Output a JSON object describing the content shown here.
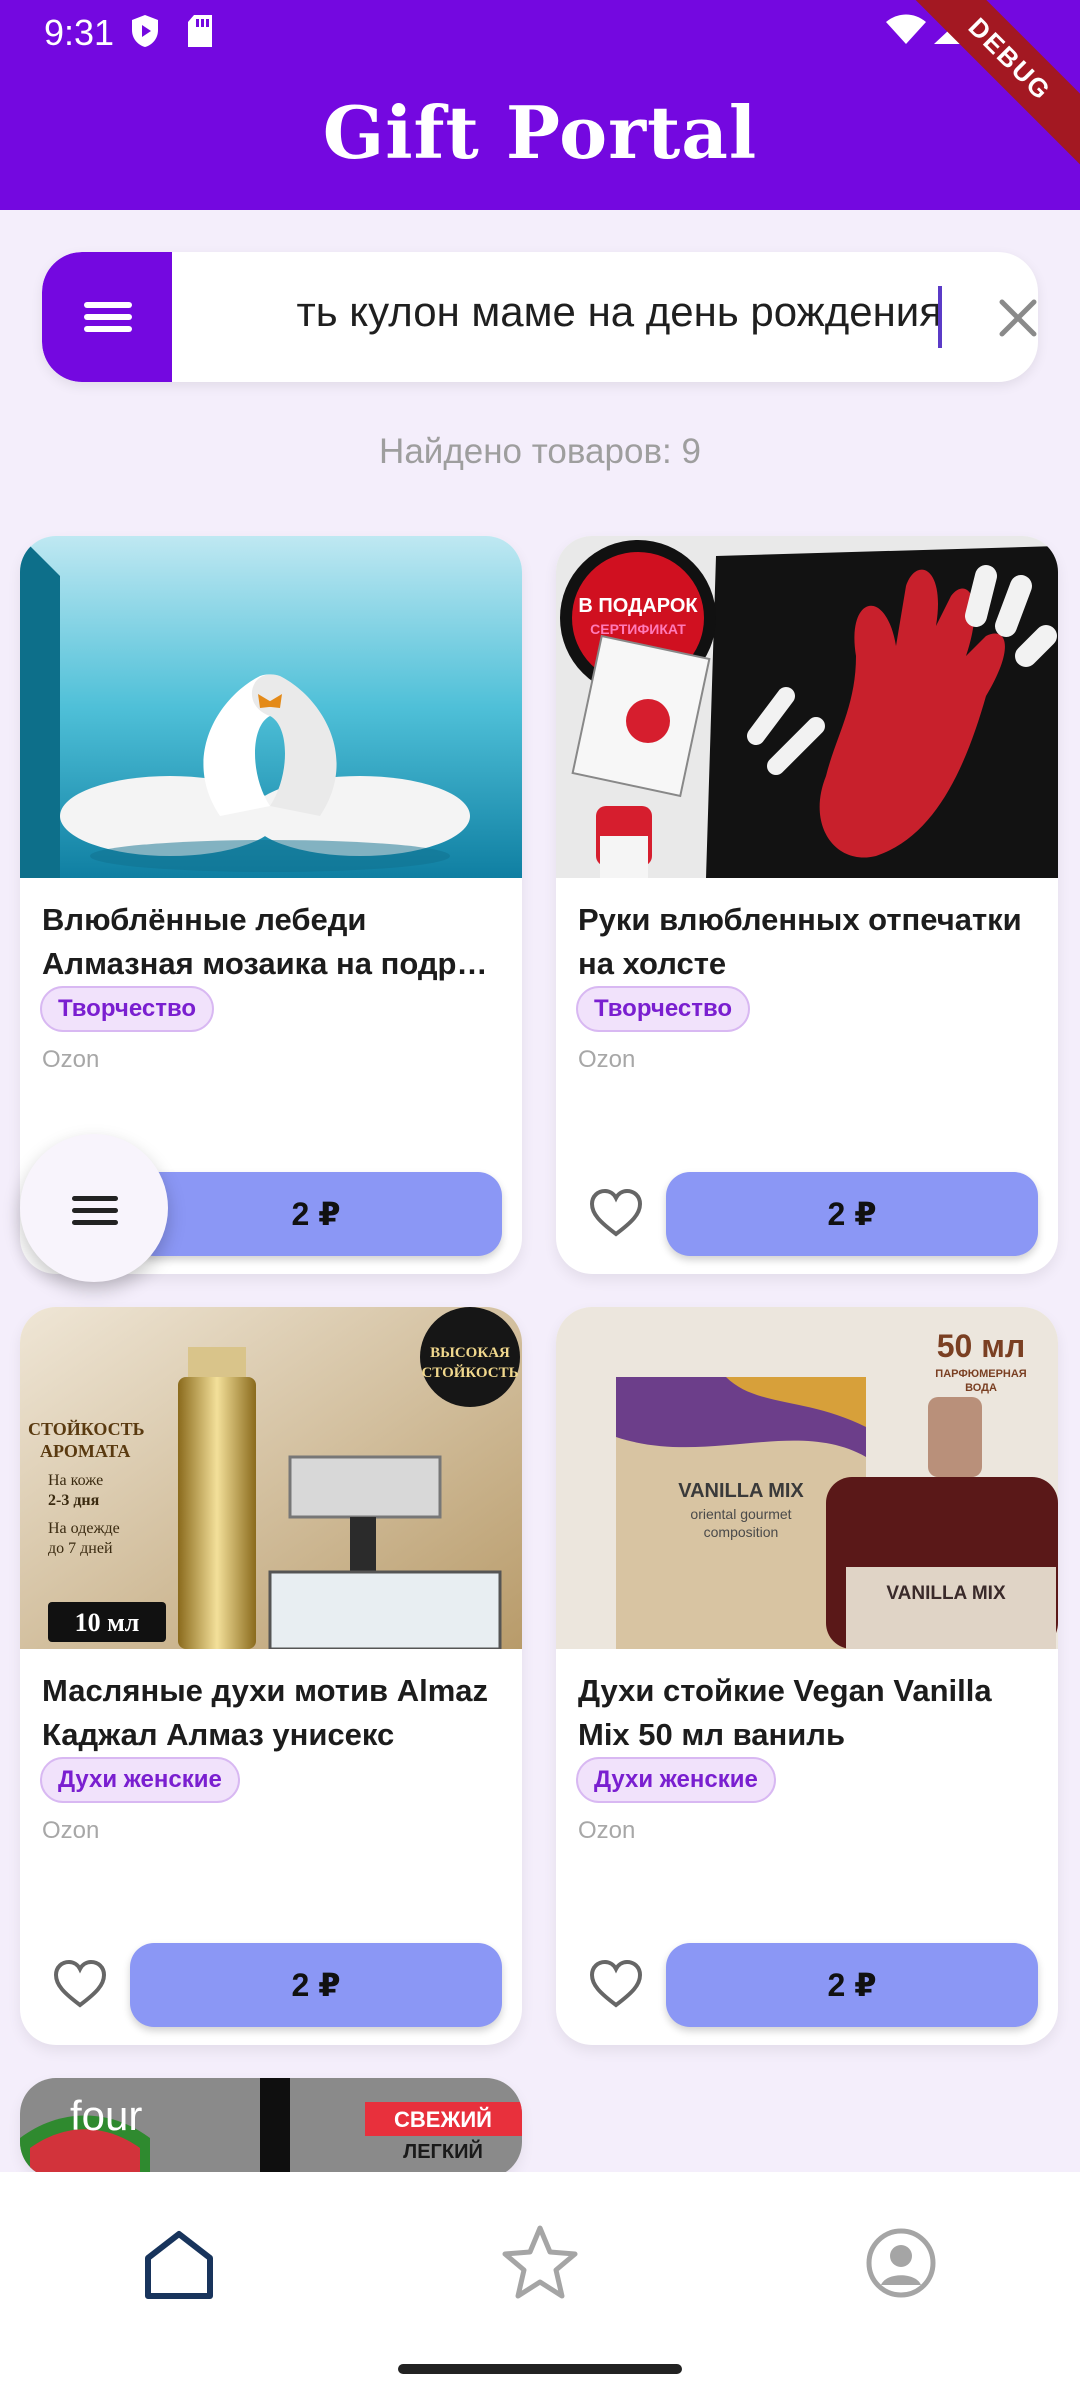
{
  "status_bar": {
    "time": "9:31"
  },
  "app": {
    "title": "Gift Portal",
    "debug_label": "DEBUG"
  },
  "search": {
    "value": "ть кулон маме на день рождения"
  },
  "results": {
    "count_text": "Найдено товаров: 9"
  },
  "products": [
    {
      "name_line1": "Влюблённые лебеди",
      "name_line2": "Алмазная мозаика на подр…",
      "category": "Творчество",
      "shop": "Ozon",
      "price": "2 ₽"
    },
    {
      "name_line1": "Руки влюбленных отпечатки",
      "name_line2": "на холсте",
      "category": "Творчество",
      "shop": "Ozon",
      "price": "2 ₽",
      "image_text": {
        "badge_line1": "В ПОДАРОК",
        "badge_line2": "СЕРТИФИКАТ"
      }
    },
    {
      "name_line1": "Масляные духи мотив Almaz",
      "name_line2": "Каджал Алмаз унисекс",
      "category": "Духи женские",
      "shop": "Ozon",
      "price": "2 ₽",
      "image_text": {
        "l1": "СТОЙКОСТЬ",
        "l2": "АРОМАТА",
        "l3": "На коже",
        "l4": "2-3 дня",
        "l5": "На одежде",
        "l6": "до 7 дней",
        "badge": "10 мл",
        "seal1": "ВЫСОКАЯ",
        "seal2": "СТОЙКОСТЬ"
      }
    },
    {
      "name_line1": "Духи стойкие Vegan Vanilla",
      "name_line2": "Mix 50 мл ваниль",
      "category": "Духи женские",
      "shop": "Ozon",
      "price": "2 ₽",
      "image_text": {
        "size": "50 мл",
        "sub1": "ПАРФЮМЕРНАЯ",
        "sub2": "ВОДА",
        "box_title": "VANILLA MIX",
        "box_sub1": "oriental gourmet",
        "box_sub2": "composition",
        "bottle_title": "VANILLA MIX"
      }
    }
  ],
  "partial_card": {
    "brand": "four",
    "badge_line1": "СВЕЖИЙ",
    "badge_line2": "ЛЕГКИЙ"
  }
}
